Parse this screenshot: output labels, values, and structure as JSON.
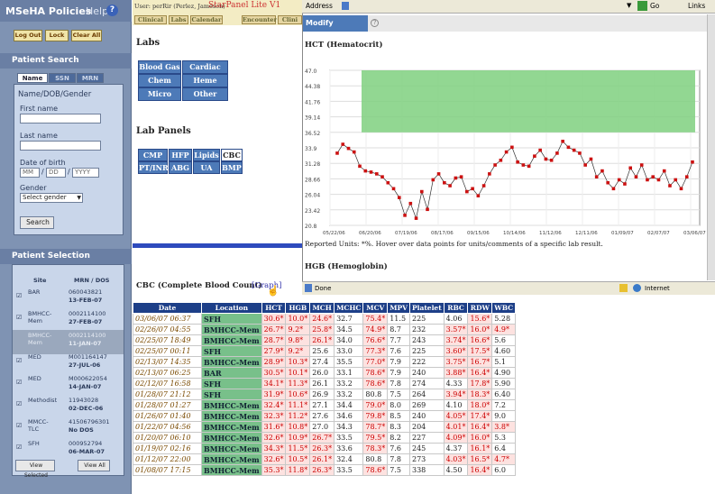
{
  "sidebar": {
    "title": "MSeHA Policies",
    "help": "Help",
    "help_icon": "help-icon",
    "logout": "Log Out",
    "lock": "Lock",
    "clear_all": "Clear All",
    "search_title": "Patient Search",
    "tabs": [
      "Name",
      "SSN",
      "MRN"
    ],
    "form_title": "Name/DOB/Gender",
    "first_label": "First name",
    "last_label": "Last name",
    "dob_label": "Date of birth",
    "dob_mm": "MM",
    "dob_dd": "DD",
    "dob_yyyy": "YYYY",
    "gender_label": "Gender",
    "gender_select": "Select gender",
    "search_btn": "Search",
    "selection_title": "Patient Selection",
    "col_site": "Site",
    "col_mrn": "MRN / DOS",
    "rows": [
      {
        "site": "BAR",
        "mrn": "060043821",
        "dos": "13-FEB-07"
      },
      {
        "site": "BMHCC-Mem",
        "mrn": "0002114100",
        "dos": "27-FEB-07"
      },
      {
        "site": "BMHCC-Mem",
        "mrn": "0002114100",
        "dos": "11-JAN-07"
      },
      {
        "site": "MED",
        "mrn": "M001164147",
        "dos": "27-JUL-06"
      },
      {
        "site": "MED",
        "mrn": "M000622054",
        "dos": "14-JAN-07"
      },
      {
        "site": "Methodist",
        "mrn": "11943028",
        "dos": "02-DEC-06"
      },
      {
        "site": "MMCC-TLC",
        "mrn": "41506796301",
        "dos": "No DOS"
      },
      {
        "site": "SFH",
        "mrn": "000952794",
        "dos": "06-MAR-07"
      }
    ],
    "view_selected": "View Selected",
    "view_all": "View All"
  },
  "mid": {
    "user": "User: perRir (Perlez, Jameson)",
    "app": "StarPanel Lite V1",
    "nav": [
      "Clinical",
      "Labs",
      "Calendar",
      "Encounter",
      "Clini"
    ],
    "labs_title": "Labs",
    "lab_btns": [
      "Blood Gas",
      "Cardiac",
      "Chem",
      "Heme",
      "Micro",
      "Other Labs"
    ],
    "panels_title": "Lab Panels",
    "panel_btns": [
      "CMP",
      "HFP",
      "Lipids",
      "CBC",
      "PT/INR",
      "ABG",
      "UA",
      "BMP"
    ],
    "cbc_title": "CBC (Complete Blood Count)",
    "graph_link": "[Graph]"
  },
  "browser": {
    "address": "Address",
    "go": "Go",
    "links": "Links",
    "modify": "Modify Graph(s)",
    "hct_title": "HCT (Hematocrit)",
    "reported": "Reported Units: *%. Hover over data points for units/comments of a specific lab result.",
    "hgb_title": "HGB (Hemoglobin)",
    "done": "Done",
    "internet": "Internet"
  },
  "chart_data": {
    "type": "line",
    "title": "HCT (Hematocrit)",
    "yticks": [
      "20.8",
      "23.42",
      "26.04",
      "28.66",
      "31.28",
      "33.9",
      "36.52",
      "39.14",
      "41.76",
      "44.38",
      "47.0"
    ],
    "ylim": [
      20.8,
      47.0
    ],
    "xticks": [
      "05/22/06",
      "06/20/06",
      "07/19/06",
      "08/17/06",
      "09/15/06",
      "10/14/06",
      "11/12/06",
      "12/11/06",
      "01/09/07",
      "02/07/07",
      "03/06/07"
    ],
    "normal_range": [
      36.52,
      47.0
    ],
    "series": [
      {
        "values": [
          33.0,
          34.5,
          33.8,
          33.2,
          30.8,
          30.0,
          29.8,
          29.5,
          29.0,
          28.0,
          27.0,
          25.5,
          22.5,
          24.5,
          22.0,
          26.5,
          23.5,
          28.5,
          29.5,
          28.0,
          27.5,
          28.8,
          29.0,
          26.5,
          27.0,
          25.8,
          27.5,
          29.5,
          31.0,
          31.8,
          33.2,
          34.0,
          31.5,
          31.0,
          30.8,
          32.5,
          33.5,
          32.0,
          31.8,
          33.0,
          35.0,
          34.0,
          33.5,
          33.0,
          31.0,
          32.0,
          29.0,
          30.0,
          28.0,
          27.0,
          28.5,
          27.8,
          30.5,
          29.0,
          31.0,
          28.5,
          29.0,
          28.5,
          30.0,
          27.5,
          28.5,
          27.0,
          29.0,
          31.5
        ]
      }
    ]
  },
  "table": {
    "headers": [
      "Date",
      "Location",
      "HCT",
      "HGB",
      "MCH",
      "MCHC",
      "MCV",
      "MPV",
      "Platelet",
      "RBC",
      "RDW",
      "WBC"
    ],
    "rows": [
      [
        "03/06/07 06:37",
        "SFH",
        "30.6*",
        "10.0*",
        "24.6*",
        "32.7",
        "75.4*",
        "11.5",
        "225",
        "4.06",
        "15.6*",
        "5.28"
      ],
      [
        "02/26/07 04:55",
        "BMHCC-Mem",
        "26.7*",
        "9.2*",
        "25.8*",
        "34.5",
        "74.9*",
        "8.7",
        "232",
        "3.57*",
        "16.0*",
        "4.9*"
      ],
      [
        "02/25/07 18:49",
        "BMHCC-Mem",
        "28.7*",
        "9.8*",
        "26.1*",
        "34.0",
        "76.6*",
        "7.7",
        "243",
        "3.74*",
        "16.6*",
        "5.6"
      ],
      [
        "02/25/07 00:11",
        "SFH",
        "27.9*",
        "9.2*",
        "25.6",
        "33.0",
        "77.3*",
        "7.6",
        "225",
        "3.60*",
        "17.5*",
        "4.60"
      ],
      [
        "02/13/07 14:35",
        "BMHCC-Mem",
        "28.9*",
        "10.3*",
        "27.4",
        "35.5",
        "77.0*",
        "7.9",
        "222",
        "3.75*",
        "16.7*",
        "5.1"
      ],
      [
        "02/13/07 06:25",
        "BAR",
        "30.5*",
        "10.1*",
        "26.0",
        "33.1",
        "78.6*",
        "7.9",
        "240",
        "3.88*",
        "16.4*",
        "4.90"
      ],
      [
        "02/12/07 16:58",
        "SFH",
        "34.1*",
        "11.3*",
        "26.1",
        "33.2",
        "78.6*",
        "7.8",
        "274",
        "4.33",
        "17.8*",
        "5.90"
      ],
      [
        "01/28/07 21:12",
        "SFH",
        "31.9*",
        "10.6*",
        "26.9",
        "33.2",
        "80.8",
        "7.5",
        "264",
        "3.94*",
        "18.3*",
        "6.40"
      ],
      [
        "01/28/07 01:27",
        "BMHCC-Mem",
        "32.4*",
        "11.1*",
        "27.1",
        "34.4",
        "79.0*",
        "8.0",
        "269",
        "4.10",
        "18.0*",
        "7.2"
      ],
      [
        "01/26/07 01:40",
        "BMHCC-Mem",
        "32.3*",
        "11.2*",
        "27.6",
        "34.6",
        "79.8*",
        "8.5",
        "240",
        "4.05*",
        "17.4*",
        "9.0"
      ],
      [
        "01/22/07 04:56",
        "BMHCC-Mem",
        "31.6*",
        "10.8*",
        "27.0",
        "34.3",
        "78.7*",
        "8.3",
        "204",
        "4.01*",
        "16.4*",
        "3.8*"
      ],
      [
        "01/20/07 06:10",
        "BMHCC-Mem",
        "32.6*",
        "10.9*",
        "26.7*",
        "33.5",
        "79.5*",
        "8.2",
        "227",
        "4.09*",
        "16.0*",
        "5.3"
      ],
      [
        "01/19/07 02:16",
        "BMHCC-Mem",
        "34.3*",
        "11.5*",
        "26.3*",
        "33.6",
        "78.3*",
        "7.6",
        "245",
        "4.37",
        "16.1*",
        "6.4"
      ],
      [
        "01/12/07 22:00",
        "BMHCC-Mem",
        "32.6*",
        "10.5*",
        "26.1*",
        "32.4",
        "80.8",
        "7.8",
        "273",
        "4.03*",
        "16.5*",
        "4.7*"
      ],
      [
        "01/08/07 17:15",
        "BMHCC-Mem",
        "35.3*",
        "11.8*",
        "26.3*",
        "33.5",
        "78.6*",
        "7.5",
        "338",
        "4.50",
        "16.4*",
        "6.0"
      ]
    ]
  },
  "colors": {
    "accent": "#1d3f88",
    "normal_band": "#7fd07f",
    "series": "#cc1111"
  }
}
